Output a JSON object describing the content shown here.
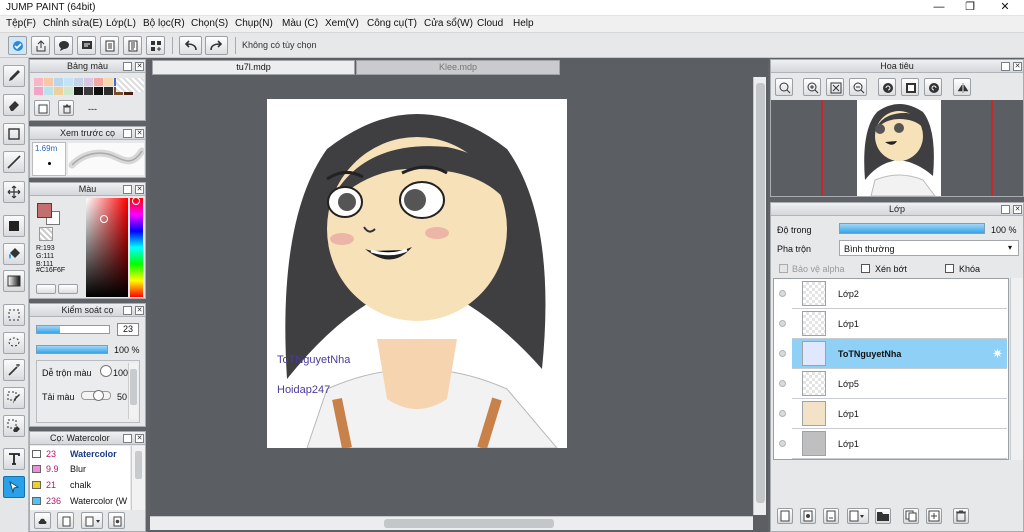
{
  "window": {
    "title": "JUMP PAINT (64bit)",
    "minimize": "—",
    "restore": "❐",
    "close": "✕"
  },
  "menu": [
    "Tệp(F)",
    "Chỉnh sửa(E)",
    "Lớp(L)",
    "Bộ lọc(R)",
    "Chọn(S)",
    "Chụp(N)",
    "Màu (C)",
    "Xem(V)",
    "Công cụ(T)",
    "Cửa sổ(W)",
    "Cloud",
    "Help"
  ],
  "toolbar": {
    "hint": "Không có tùy chọn"
  },
  "palette": {
    "title": "Bảng màu",
    "swatches": [
      "#f7b5c7",
      "#f6c8a4",
      "#b9d6ef",
      "#c5e3f7",
      "#c4d4e6",
      "#d8c6e6",
      "#f2a8a0",
      "#f7d7ae",
      "#3b6fd6",
      "#e9e9e9",
      "#f4a3c5",
      "#b9e2ec",
      "#f0d09a",
      "#cfe8c9",
      "#1b1b1b",
      "#3a3a3a",
      "#101010",
      "#2c2c2c",
      "#7a4a2c",
      "#4a1e10"
    ],
    "label": "---"
  },
  "brush_preview": {
    "title": "Xem trước cọ",
    "size": "1.69m"
  },
  "color": {
    "title": "Màu",
    "r": "R:193",
    "g": "G:111",
    "b": "B:111",
    "hex": "#C16F6F",
    "current": "#c16f6f"
  },
  "brush_control": {
    "title": "Kiểm soát cọ",
    "size_value": "23",
    "size_level": 0.32,
    "opacity_value": "100 %",
    "opacity_level": 1.0,
    "blend_label": "Dễ trộn màu",
    "blend_value": "100",
    "load_label": "Tải màu",
    "load_value": "50"
  },
  "brushes": {
    "title": "Cọ: Watercolor",
    "items": [
      {
        "size": "23",
        "name": "Watercolor",
        "color": "#ffffff",
        "selected": true
      },
      {
        "size": "9.9",
        "name": "Blur",
        "color": "#f08ce0",
        "selected": false
      },
      {
        "size": "21",
        "name": "chalk",
        "color": "#f0d020",
        "selected": false
      },
      {
        "size": "236",
        "name": "Watercolor (W",
        "color": "#4fc3f7",
        "selected": false
      }
    ]
  },
  "tabs": [
    {
      "label": "tu7l.mdp",
      "active": true
    },
    {
      "label": "Klee.mdp",
      "active": false
    }
  ],
  "artwork": {
    "watermark_1": "ToTNguyetNha",
    "watermark_2": "Hoidap247"
  },
  "navigator": {
    "title": "Hoa tiêu"
  },
  "layers_panel": {
    "title": "Lớp",
    "opacity_label": "Độ trong",
    "opacity_value": "100 %",
    "opacity_level": 1.0,
    "blend_label": "Pha trộn",
    "blend_value": "Bình thường",
    "protect_alpha": "Bảo vệ alpha",
    "clipping": "Xén bớt",
    "lock": "Khóa",
    "layers": [
      {
        "name": "Lớp2",
        "selected": false
      },
      {
        "name": "Lớp1",
        "selected": false
      },
      {
        "name": "ToTNguyetNha",
        "selected": true
      },
      {
        "name": "Lớp5",
        "selected": false
      },
      {
        "name": "Lớp1",
        "selected": false
      },
      {
        "name": "Lớp1",
        "selected": false
      }
    ]
  }
}
